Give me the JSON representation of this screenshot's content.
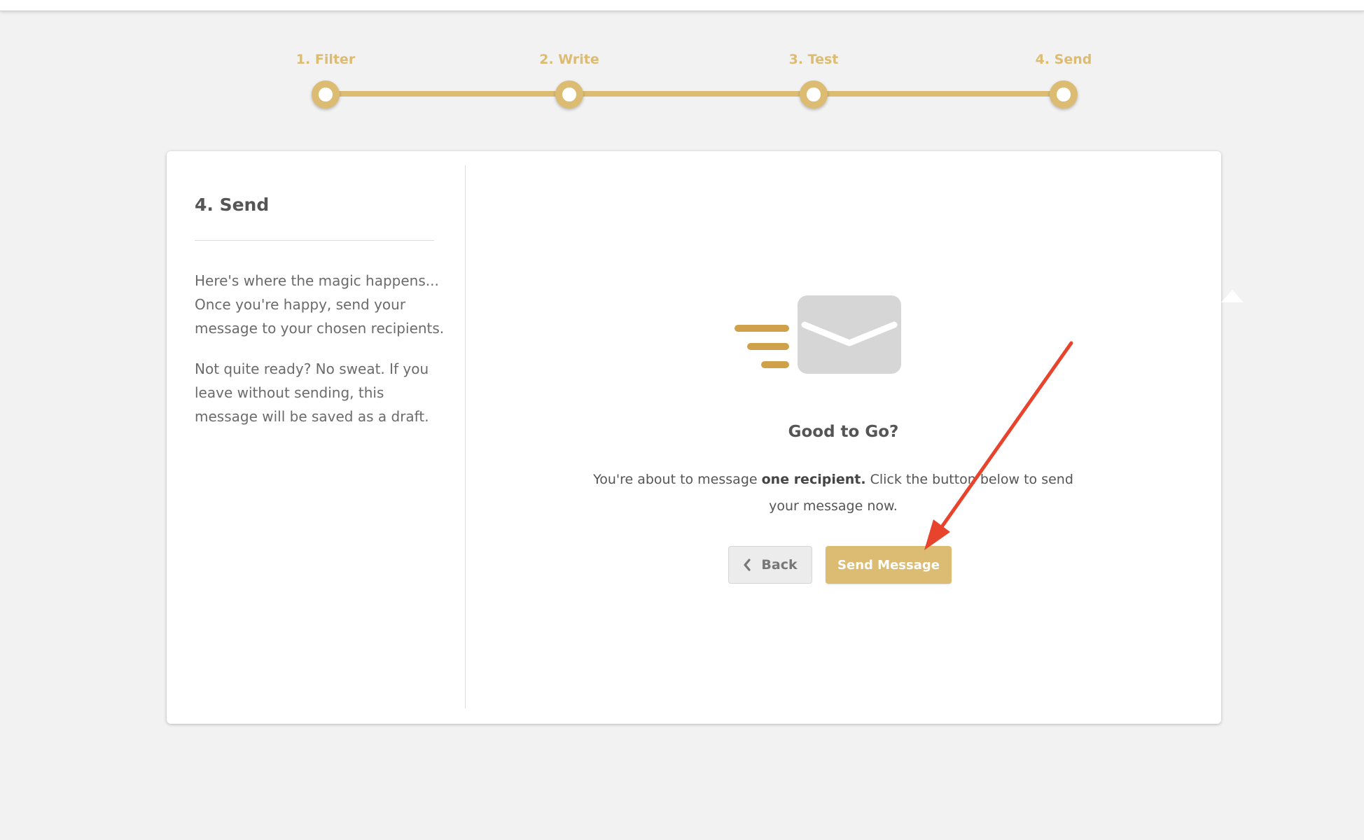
{
  "stepper": {
    "steps": [
      {
        "label": "1. Filter"
      },
      {
        "label": "2. Write"
      },
      {
        "label": "3. Test"
      },
      {
        "label": "4. Send"
      }
    ],
    "active_step": "4. Send"
  },
  "sidebar": {
    "title": "4. Send",
    "paragraph1": "Here's where the magic happens... Once you're happy, send your message to your chosen recipients.",
    "paragraph2": "Not quite ready? No sweat. If you leave without sending, this message will be saved as a draft."
  },
  "main": {
    "icon": "envelope-icon",
    "title": "Good to Go?",
    "text_before": "You're about to message ",
    "text_bold": "one recipient.",
    "text_after": " Click the button below to send your message now.",
    "back_label": "Back",
    "back_icon": "chevron-left-icon",
    "send_label": "Send Message"
  },
  "colors": {
    "accent": "#dcbc73",
    "icon_gold": "#cfa14a",
    "envelope_gray": "#d6d6d6",
    "background": "#f2f2f2",
    "annotation_arrow": "#e8432d"
  }
}
